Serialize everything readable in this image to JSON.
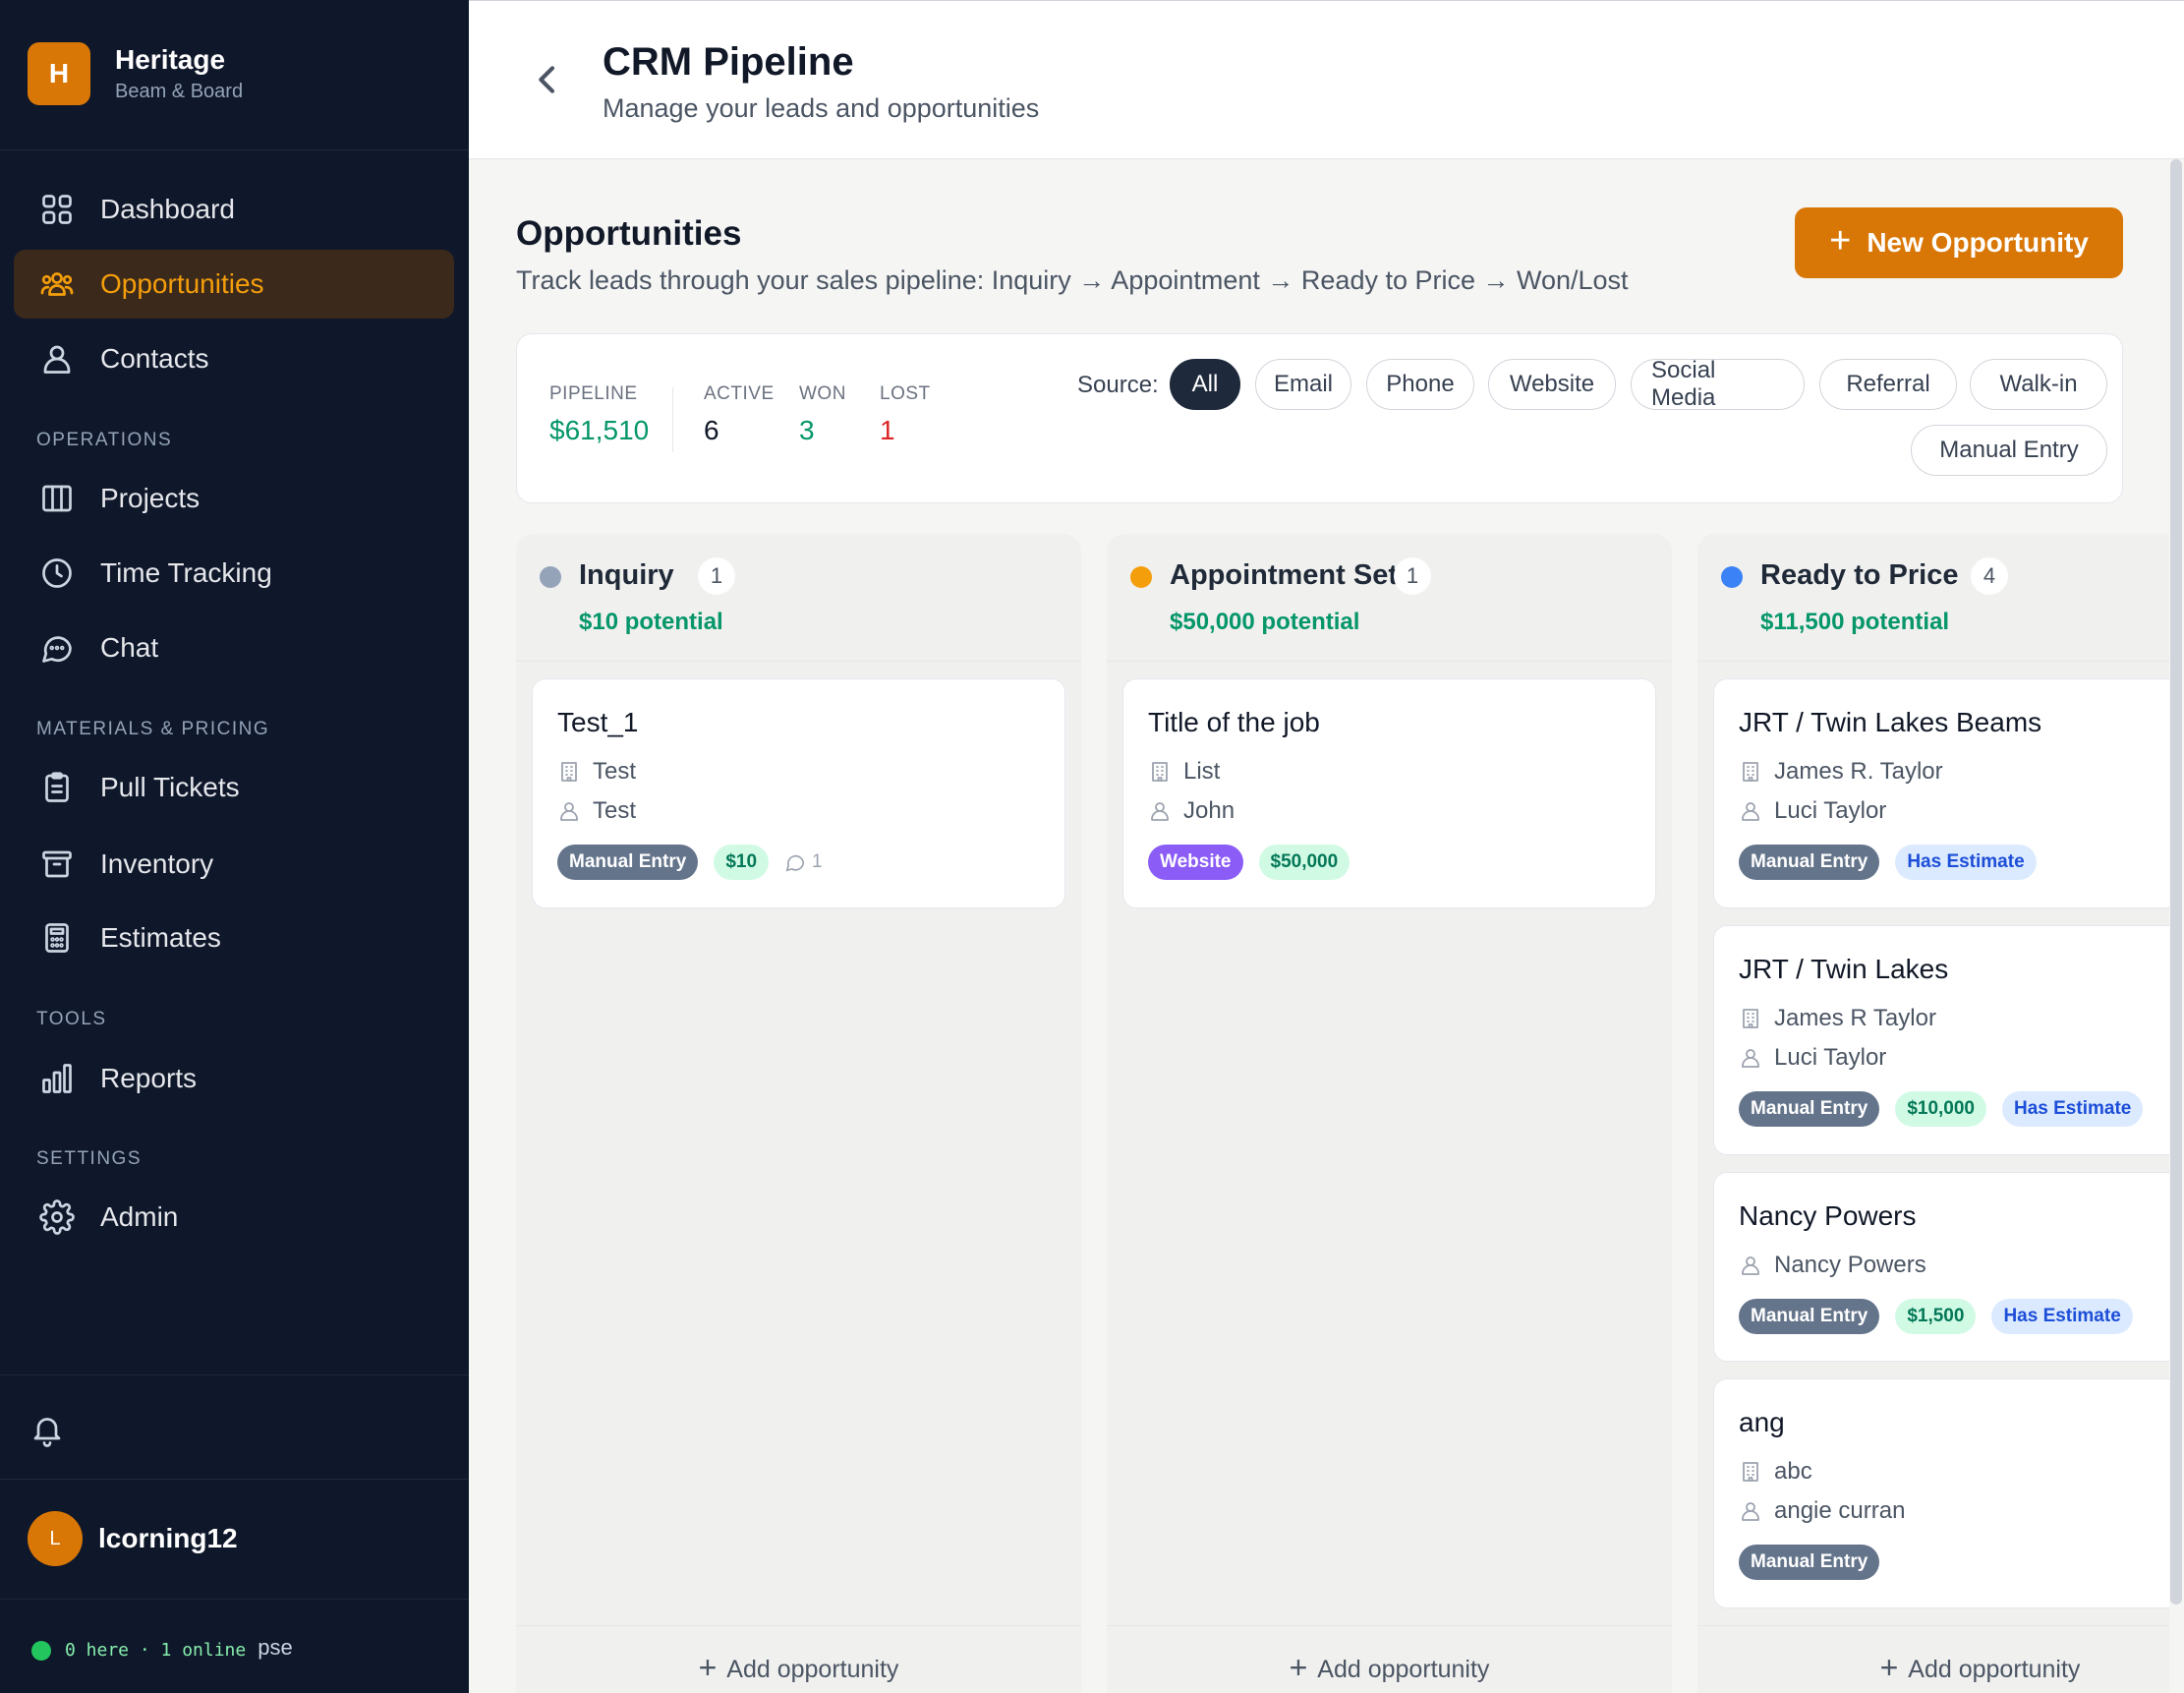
{
  "brand": {
    "initial": "H",
    "name": "Heritage",
    "subtitle": "Beam & Board"
  },
  "nav": {
    "dashboard": "Dashboard",
    "opportunities": "Opportunities",
    "contacts": "Contacts",
    "section_operations": "OPERATIONS",
    "projects": "Projects",
    "time_tracking": "Time Tracking",
    "chat": "Chat",
    "section_materials": "MATERIALS & PRICING",
    "pull_tickets": "Pull Tickets",
    "inventory": "Inventory",
    "estimates": "Estimates",
    "section_tools": "TOOLS",
    "reports": "Reports",
    "section_settings": "SETTINGS",
    "admin": "Admin",
    "active": "opportunities"
  },
  "user": {
    "initial": "L",
    "name": "lcorning12"
  },
  "presence": {
    "text": "0 here · 1 online",
    "tail": "pse"
  },
  "header": {
    "title": "CRM Pipeline",
    "subtitle": "Manage your leads and opportunities"
  },
  "section": {
    "title": "Opportunities",
    "subtitle": "Track leads through your sales pipeline: Inquiry → Appointment → Ready to Price → Won/Lost",
    "new_button": "New Opportunity"
  },
  "stats": {
    "pipeline_label": "PIPELINE",
    "pipeline_value": "$61,510",
    "active_label": "ACTIVE",
    "active_value": "6",
    "won_label": "WON",
    "won_value": "3",
    "lost_label": "LOST",
    "lost_value": "1"
  },
  "source_filter": {
    "label": "Source:",
    "options": [
      "All",
      "Email",
      "Phone",
      "Website",
      "Social Media",
      "Referral",
      "Walk-in",
      "Manual Entry"
    ],
    "selected": "All"
  },
  "columns": [
    {
      "name": "Inquiry",
      "count": "1",
      "potential": "$10 potential",
      "color": "#94a3b8",
      "add_label": "Add opportunity",
      "cards": [
        {
          "title": "Test_1",
          "company": "Test",
          "contact": "Test",
          "source": "Manual Entry",
          "value": "$10",
          "comments": "1"
        }
      ]
    },
    {
      "name": "Appointment Set",
      "count": "1",
      "potential": "$50,000 potential",
      "color": "#f59e0b",
      "add_label": "Add opportunity",
      "cards": [
        {
          "title": "Title of the job",
          "company": "List",
          "contact": "John",
          "source": "Website",
          "value": "$50,000"
        }
      ]
    },
    {
      "name": "Ready to Price",
      "count": "4",
      "potential": "$11,500 potential",
      "color": "#3b82f6",
      "add_label": "Add opportunity",
      "cards": [
        {
          "title": "JRT / Twin Lakes Beams",
          "company": "James R. Taylor",
          "contact": "Luci Taylor",
          "source": "Manual Entry",
          "estimate": "Has Estimate"
        },
        {
          "title": "JRT / Twin Lakes",
          "company": "James R Taylor",
          "contact": "Luci Taylor",
          "source": "Manual Entry",
          "value": "$10,000",
          "estimate": "Has Estimate"
        },
        {
          "title": "Nancy Powers",
          "contact": "Nancy Powers",
          "source": "Manual Entry",
          "value": "$1,500",
          "estimate": "Has Estimate"
        },
        {
          "title": "ang",
          "company": "abc",
          "contact": "angie curran",
          "source": "Manual Entry"
        }
      ]
    }
  ],
  "colors": {
    "accent": "#d97706",
    "sidebar": "#0f172a",
    "money": "#059669",
    "lost": "#dc2626"
  }
}
